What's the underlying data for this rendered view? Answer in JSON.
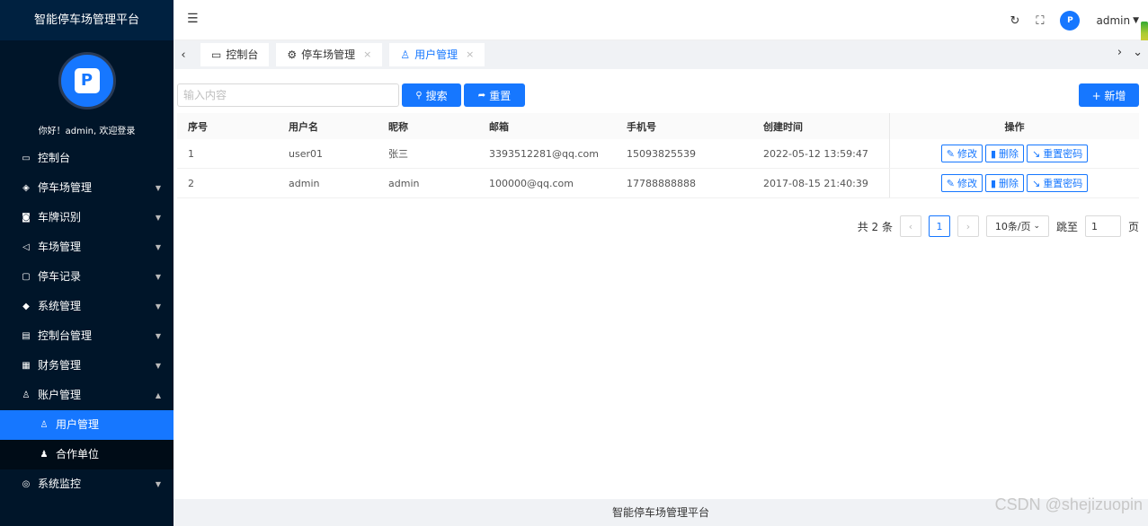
{
  "app": {
    "title": "智能停车场管理平台",
    "welcome": "你好！admin, 欢迎登录",
    "logo_letter": "P"
  },
  "sidebar": {
    "items": [
      {
        "label": "控制台",
        "icon": "monitor-icon",
        "glyph": "▭",
        "has_arrow": false
      },
      {
        "label": "停车场管理",
        "icon": "shield-icon",
        "glyph": "◈",
        "has_arrow": true
      },
      {
        "label": "车牌识别",
        "icon": "camera-icon",
        "glyph": "◙",
        "has_arrow": true
      },
      {
        "label": "车场管理",
        "icon": "send-icon",
        "glyph": "◁",
        "has_arrow": true
      },
      {
        "label": "停车记录",
        "icon": "file-icon",
        "glyph": "▢",
        "has_arrow": true
      },
      {
        "label": "系统管理",
        "icon": "layers-icon",
        "glyph": "◆",
        "has_arrow": true
      },
      {
        "label": "控制台管理",
        "icon": "calendar-icon",
        "glyph": "▤",
        "has_arrow": true
      },
      {
        "label": "财务管理",
        "icon": "apps-icon",
        "glyph": "▦",
        "has_arrow": true
      },
      {
        "label": "账户管理",
        "icon": "user-icon",
        "glyph": "♙",
        "has_arrow": true,
        "expanded": true
      }
    ],
    "sub_items": [
      {
        "label": "用户管理",
        "icon": "user-outline-icon",
        "glyph": "♙",
        "active": true
      },
      {
        "label": "合作单位",
        "icon": "user-solid-icon",
        "glyph": "♟",
        "active": false
      }
    ],
    "last_item": {
      "label": "系统监控",
      "icon": "camera-outline-icon",
      "glyph": "◎"
    }
  },
  "header": {
    "user": "admin"
  },
  "tabs": [
    {
      "label": "控制台",
      "icon": "monitor-icon",
      "glyph": "▭",
      "closable": false,
      "active": false
    },
    {
      "label": "停车场管理",
      "icon": "gear-icon",
      "glyph": "⚙",
      "closable": true,
      "active": false
    },
    {
      "label": "用户管理",
      "icon": "user-icon",
      "glyph": "♙",
      "closable": true,
      "active": true
    }
  ],
  "toolbar": {
    "search_placeholder": "输入内容",
    "search_label": "搜索",
    "reset_label": "重置",
    "add_label": "+ 新增"
  },
  "table": {
    "columns": [
      "序号",
      "用户名",
      "昵称",
      "邮箱",
      "手机号",
      "创建时间",
      "操作"
    ],
    "rows": [
      [
        "1",
        "user01",
        "张三",
        "3393512281@qq.com",
        "15093825539",
        "2022-05-12 13:59:47"
      ],
      [
        "2",
        "admin",
        "admin",
        "100000@qq.com",
        "17788888888",
        "2017-08-15 21:40:39"
      ]
    ],
    "actions": {
      "edit": "修改",
      "delete": "删除",
      "reset_pwd": "重置密码"
    }
  },
  "pagination": {
    "total": "共 2 条",
    "current": "1",
    "page_size": "10条/页",
    "jump_label": "跳至",
    "jump_value": "1",
    "page_unit": "页"
  },
  "footer": {
    "text": "智能停车场管理平台"
  },
  "watermark": "CSDN @shejizuopin",
  "colors": {
    "primary": "#1677ff",
    "sidebar_bg": "#001529"
  }
}
